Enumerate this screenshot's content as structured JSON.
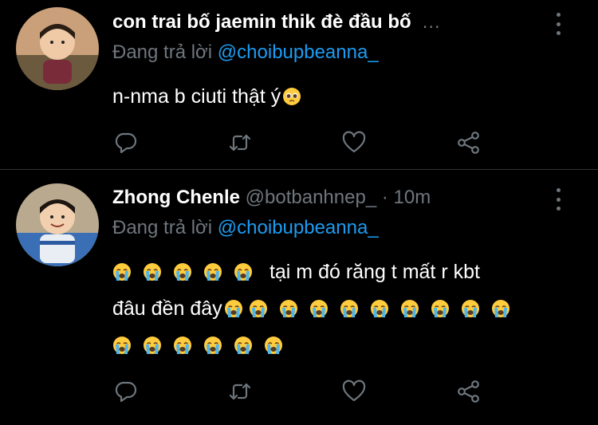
{
  "colors": {
    "background": "#000000",
    "text": "#ffffff",
    "secondary": "#6e767d",
    "link": "#1d9bf0",
    "divider": "#2f3336"
  },
  "tweets": [
    {
      "name": "con trai bố jaemin thik đè đầu bố",
      "ellipsis": "...",
      "reply_prefix": "Đang trả lời",
      "mention": "@choibupbeanna_",
      "text": "n-nma b ciuti thật ý",
      "emoji": "pleading-face",
      "actions": [
        "reply-icon",
        "retweet-icon",
        "like-icon",
        "share-icon"
      ]
    },
    {
      "name": "Zhong Chenle",
      "handle": "@botbanhnep_",
      "dot": "·",
      "time": "10m",
      "reply_prefix": "Đang trả lời",
      "mention": "@choibupbeanna_",
      "text_line1": "tại m đó răng t mất r kbt",
      "text_line2": "đâu đền đây",
      "emoji": "loudly-crying-face",
      "actions": [
        "reply-icon",
        "retweet-icon",
        "like-icon",
        "share-icon"
      ]
    }
  ]
}
